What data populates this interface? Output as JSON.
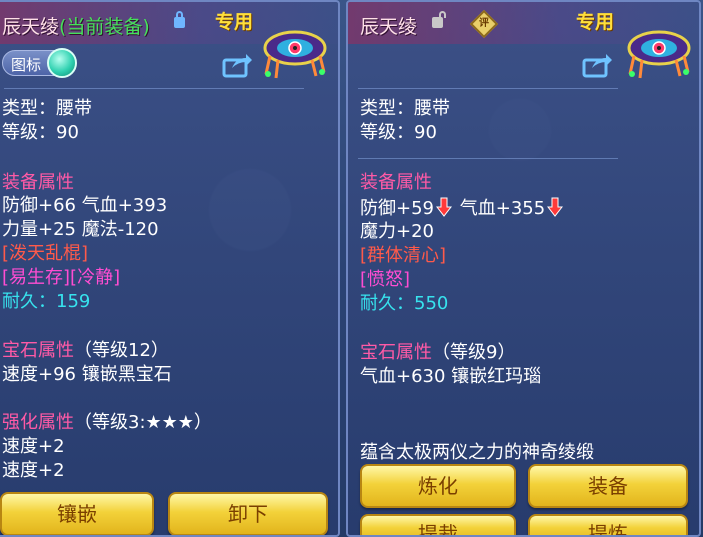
{
  "left": {
    "name": "辰天绫",
    "equipped_tag": "(当前装备)",
    "special": "专用",
    "toggle_label": "图标",
    "type_line": "类型：腰带",
    "level_line": "等级：90",
    "attr_title": "装备属性",
    "attr_line1": "防御+66 气血+393",
    "attr_line2": "力量+25 魔法-120",
    "skill1": "[泼天乱棍]",
    "skill2": "[易生存][冷静]",
    "durability_label": "耐久：",
    "durability_value": "159",
    "gem_title": "宝石属性",
    "gem_level": "（等级12）",
    "gem_line": "速度+96 镶嵌黑宝石",
    "enh_title": "强化属性",
    "enh_level": "（等级3:★★★）",
    "enh_line1": "速度+2",
    "enh_line2": "速度+2",
    "btn_inlay": "镶嵌",
    "btn_unequip": "卸下"
  },
  "right": {
    "name": "辰天绫",
    "review": "评",
    "special": "专用",
    "type_line": "类型：腰带",
    "level_line": "等级：90",
    "attr_title": "装备属性",
    "attr_def": "防御+59",
    "attr_hp": "气血+355",
    "attr_line2": "魔力+20",
    "skill1": "[群体清心]",
    "skill2": "[愤怒]",
    "durability_label": "耐久：",
    "durability_value": "550",
    "gem_title": "宝石属性",
    "gem_level": "（等级9）",
    "gem_line": "气血+630 镶嵌红玛瑙",
    "description": "蕴含太极两仪之力的神奇绫缎",
    "btn_refine": "炼化",
    "btn_equip": "装备",
    "btn_bottom1": "提裁",
    "btn_bottom2": "提炼"
  },
  "colors": {
    "section_title": "#ff5aa6",
    "equip_tag": "#46e05a",
    "skill_red": "#ff5a4a",
    "skill_pink": "#ff4dd2",
    "durability": "#37e3ee",
    "button": "#f3d23a"
  },
  "icons": [
    "lock-icon",
    "unlock-icon",
    "review-icon",
    "share-icon",
    "belt-icon",
    "down-arrow-icon"
  ]
}
